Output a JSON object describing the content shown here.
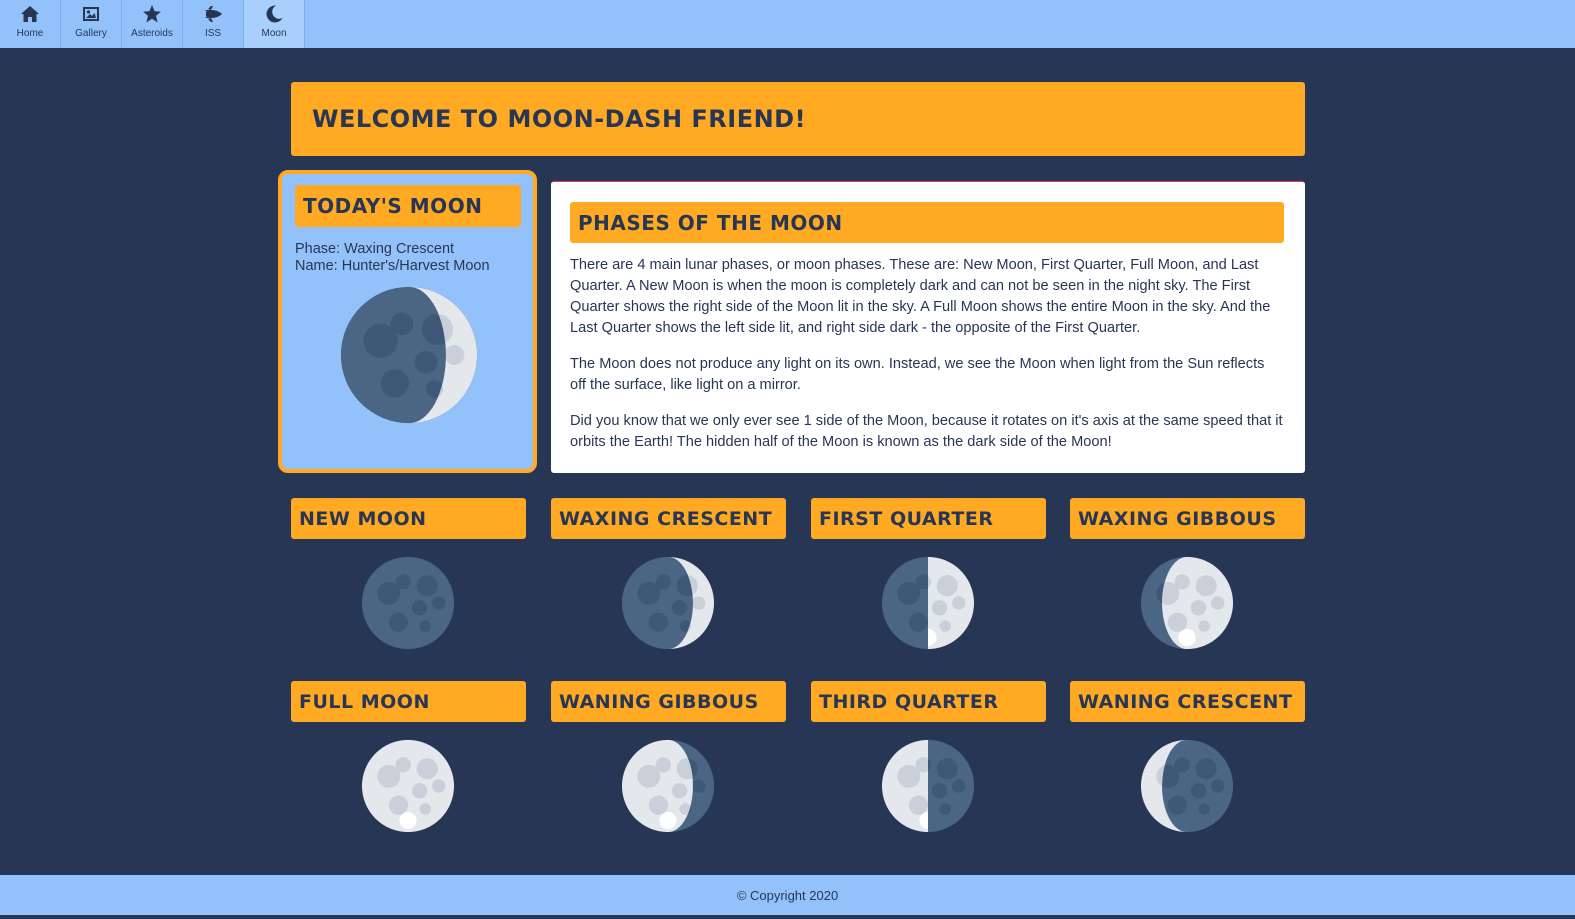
{
  "nav": {
    "items": [
      {
        "label": "Home",
        "icon": "home-icon"
      },
      {
        "label": "Gallery",
        "icon": "image-icon"
      },
      {
        "label": "Asteroids",
        "icon": "star-icon"
      },
      {
        "label": "ISS",
        "icon": "space-shuttle-icon"
      },
      {
        "label": "Moon",
        "icon": "moon-icon"
      }
    ],
    "active": "Moon"
  },
  "banner": {
    "title": "Welcome to Moon-Dash Friend!"
  },
  "today": {
    "title": "Today's Moon",
    "phase_line": "Phase: Waxing Crescent",
    "name_line": "Name: Hunter's/Harvest Moon",
    "moon_illustration": "waxing-crescent"
  },
  "phases_info": {
    "title": "Phases of the Moon",
    "paragraphs": [
      "There are 4 main lunar phases, or moon phases. These are: New Moon, First Quarter, Full Moon, and Last Quarter. A New Moon is when the moon is completely dark and can not be seen in the night sky. The First Quarter shows the right side of the Moon lit in the sky. A Full Moon shows the entire Moon in the sky. And the Last Quarter shows the left side lit, and right side dark - the opposite of the First Quarter.",
      "The Moon does not produce any light on its own. Instead, we see the Moon when light from the Sun reflects off the surface, like light on a mirror.",
      "Did you know that we only ever see 1 side of the Moon, because it rotates on it's axis at the same speed that it orbits the Earth! The hidden half of the Moon is known as the dark side of the Moon!"
    ]
  },
  "phase_cards": [
    {
      "label": "New Moon",
      "illustration": "new"
    },
    {
      "label": "Waxing Crescent",
      "illustration": "waxing-crescent"
    },
    {
      "label": "First Quarter",
      "illustration": "first-quarter"
    },
    {
      "label": "Waxing Gibbous",
      "illustration": "waxing-gibbous"
    },
    {
      "label": "Full Moon",
      "illustration": "full"
    },
    {
      "label": "Waning Gibbous",
      "illustration": "waning-gibbous"
    },
    {
      "label": "Third Quarter",
      "illustration": "third-quarter"
    },
    {
      "label": "Waning Crescent",
      "illustration": "waning-crescent"
    }
  ],
  "footer": {
    "text": "© Copyright 2020"
  },
  "colors": {
    "background": "#283655",
    "nav": "#93c2fb",
    "accent": "#ffaa22",
    "moon_dark": "#4b6585",
    "moon_light": "#e4e7ec"
  }
}
